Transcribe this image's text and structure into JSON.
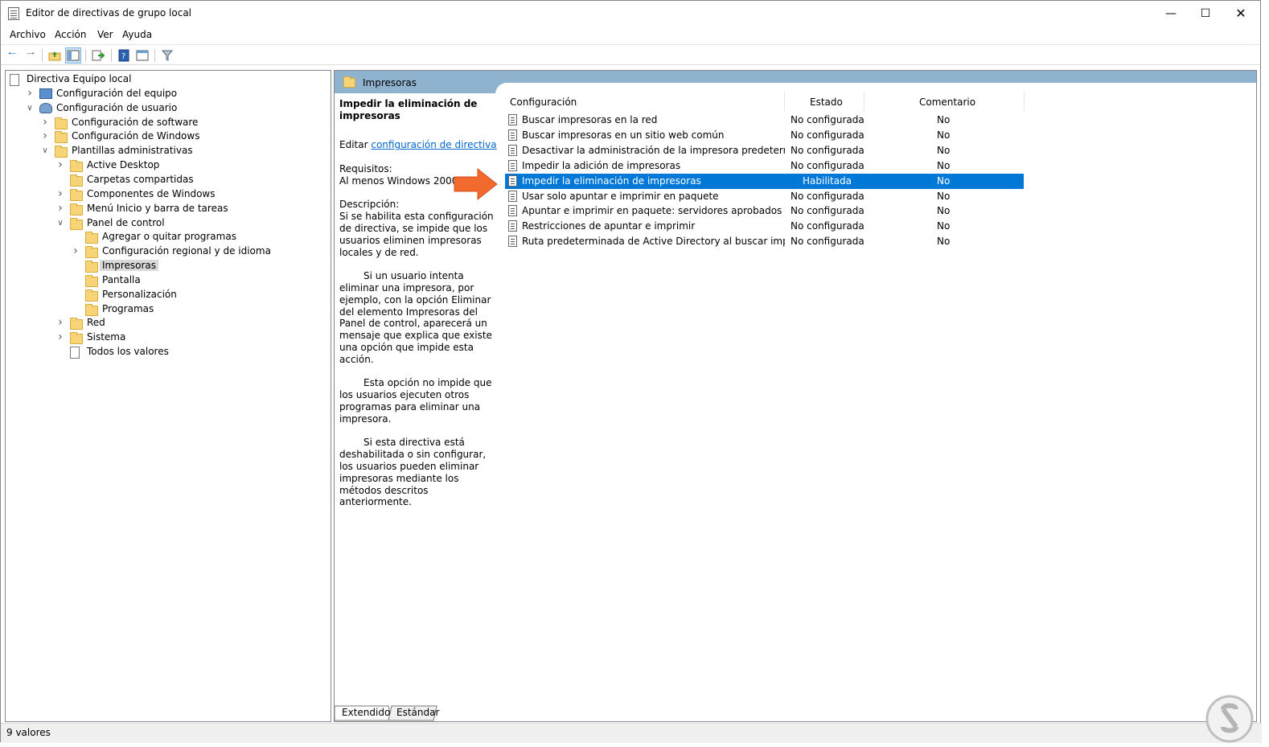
{
  "window": {
    "title": "Editor de directivas de grupo local"
  },
  "menu": [
    "Archivo",
    "Acción",
    "Ver",
    "Ayuda"
  ],
  "tree": [
    {
      "label": "Directiva Equipo local",
      "depth": 0,
      "icon": "policy-doc-icon",
      "chevron": ""
    },
    {
      "label": "Configuración del equipo",
      "depth": 1,
      "icon": "computer-icon",
      "chevron": ">"
    },
    {
      "label": "Configuración de usuario",
      "depth": 1,
      "icon": "user-icon",
      "chevron": "v"
    },
    {
      "label": "Configuración de software",
      "depth": 2,
      "icon": "folder-icon",
      "chevron": ">"
    },
    {
      "label": "Configuración de Windows",
      "depth": 2,
      "icon": "folder-icon",
      "chevron": ">"
    },
    {
      "label": "Plantillas administrativas",
      "depth": 2,
      "icon": "folder-icon",
      "chevron": "v"
    },
    {
      "label": "Active Desktop",
      "depth": 3,
      "icon": "folder-icon",
      "chevron": ">"
    },
    {
      "label": "Carpetas compartidas",
      "depth": 3,
      "icon": "folder-icon",
      "chevron": ""
    },
    {
      "label": "Componentes de Windows",
      "depth": 3,
      "icon": "folder-icon",
      "chevron": ">"
    },
    {
      "label": "Menú Inicio y barra de tareas",
      "depth": 3,
      "icon": "folder-icon",
      "chevron": ">"
    },
    {
      "label": "Panel de control",
      "depth": 3,
      "icon": "folder-icon",
      "chevron": "v"
    },
    {
      "label": "Agregar o quitar programas",
      "depth": 4,
      "icon": "folder-icon",
      "chevron": ""
    },
    {
      "label": "Configuración regional y de idioma",
      "depth": 4,
      "icon": "folder-icon",
      "chevron": ">"
    },
    {
      "label": "Impresoras",
      "depth": 4,
      "icon": "folder-icon",
      "chevron": "",
      "selected": true
    },
    {
      "label": "Pantalla",
      "depth": 4,
      "icon": "folder-icon",
      "chevron": ""
    },
    {
      "label": "Personalización",
      "depth": 4,
      "icon": "folder-icon",
      "chevron": ""
    },
    {
      "label": "Programas",
      "depth": 4,
      "icon": "folder-icon",
      "chevron": ""
    },
    {
      "label": "Red",
      "depth": 3,
      "icon": "folder-icon",
      "chevron": ">"
    },
    {
      "label": "Sistema",
      "depth": 3,
      "icon": "folder-icon",
      "chevron": ">"
    },
    {
      "label": "Todos los valores",
      "depth": 3,
      "icon": "all-settings-icon",
      "chevron": ""
    }
  ],
  "right_header": {
    "title": "Impresoras"
  },
  "description": {
    "title": "Impedir la eliminación de impresoras",
    "edit_prefix": "Editar",
    "edit_link": "configuración de directiva",
    "requirements_label": "Requisitos:",
    "requirements_value": "Al menos Windows 2000",
    "description_label": "Descripción:",
    "para1": "Si se habilita esta configuración de directiva, se impide que los usuarios eliminen impresoras locales y de red.",
    "para2": "Si un usuario intenta eliminar una impresora, por ejemplo, con la opción Eliminar del elemento Impresoras del Panel de control, aparecerá un mensaje que explica que existe una opción que impide esta acción.",
    "para3": "Esta opción no impide que los usuarios ejecuten otros programas para eliminar una impresora.",
    "para4": "Si esta directiva está deshabilitada o sin configurar, los usuarios pueden eliminar impresoras mediante los métodos descritos anteriormente."
  },
  "list": {
    "columns": [
      "Configuración",
      "Estado",
      "Comentario"
    ],
    "rows": [
      {
        "name": "Buscar impresoras en la red",
        "state": "No configurada",
        "comment": "No"
      },
      {
        "name": "Buscar impresoras en un sitio web común",
        "state": "No configurada",
        "comment": "No"
      },
      {
        "name": "Desactivar la administración de la impresora predeterminad...",
        "state": "No configurada",
        "comment": "No"
      },
      {
        "name": "Impedir la adición de impresoras",
        "state": "No configurada",
        "comment": "No"
      },
      {
        "name": "Impedir la eliminación de impresoras",
        "state": "Habilitada",
        "comment": "No",
        "selected": true
      },
      {
        "name": "Usar solo apuntar e imprimir en paquete",
        "state": "No configurada",
        "comment": "No"
      },
      {
        "name": "Apuntar e imprimir en paquete: servidores aprobados",
        "state": "No configurada",
        "comment": "No"
      },
      {
        "name": "Restricciones de apuntar e imprimir",
        "state": "No configurada",
        "comment": "No"
      },
      {
        "name": "Ruta predeterminada de Active Directory al buscar impresoras",
        "state": "No configurada",
        "comment": "No"
      }
    ]
  },
  "tabs": [
    "Extendido",
    "Estándar"
  ],
  "status": {
    "text": "9 valores"
  },
  "colors": {
    "selection": "#0078d7",
    "header": "#8fb2cf",
    "arrow": "#f26a2e",
    "link": "#0066cc"
  }
}
